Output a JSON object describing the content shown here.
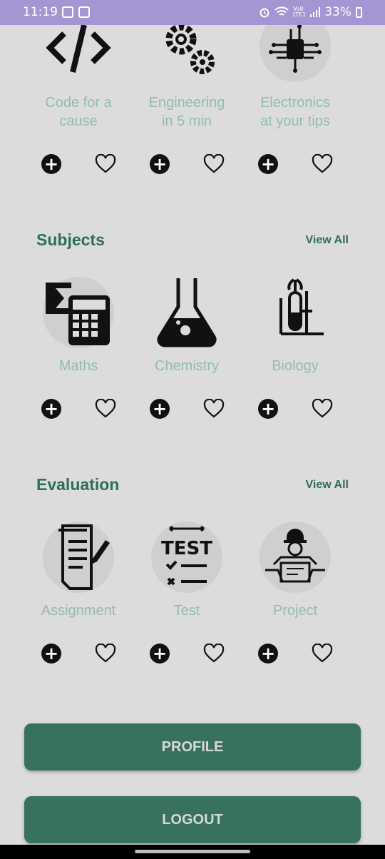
{
  "status_bar": {
    "time": "11:19",
    "network_label": "Vo8\nLTE1",
    "battery_percent": "33%"
  },
  "top_row": {
    "items": [
      {
        "label": "Code for a\ncause",
        "icon": "code-icon"
      },
      {
        "label": "Engineering\nin 5 min",
        "icon": "gears-icon"
      },
      {
        "label": "Electronics\nat your tips",
        "icon": "chip-icon"
      }
    ]
  },
  "subjects": {
    "title": "Subjects",
    "view_all": "View All",
    "items": [
      {
        "label": "Maths",
        "icon": "calculator-icon"
      },
      {
        "label": "Chemistry",
        "icon": "flask-icon"
      },
      {
        "label": "Biology",
        "icon": "test-tube-plant-icon"
      }
    ]
  },
  "evaluation": {
    "title": "Evaluation",
    "view_all": "View All",
    "items": [
      {
        "label": "Assignment",
        "icon": "document-pen-icon"
      },
      {
        "label": "Test",
        "icon": "test-checklist-icon"
      },
      {
        "label": "Project",
        "icon": "engineer-blueprint-icon"
      }
    ]
  },
  "test_badge": "TEST",
  "buttons": {
    "profile": "PROFILE",
    "logout": "LOGOUT"
  },
  "colors": {
    "status_bar": "#a496d2",
    "accent": "#2f6d5f",
    "button": "#387160",
    "label": "#94bcae",
    "background": "#dcdcdc"
  }
}
